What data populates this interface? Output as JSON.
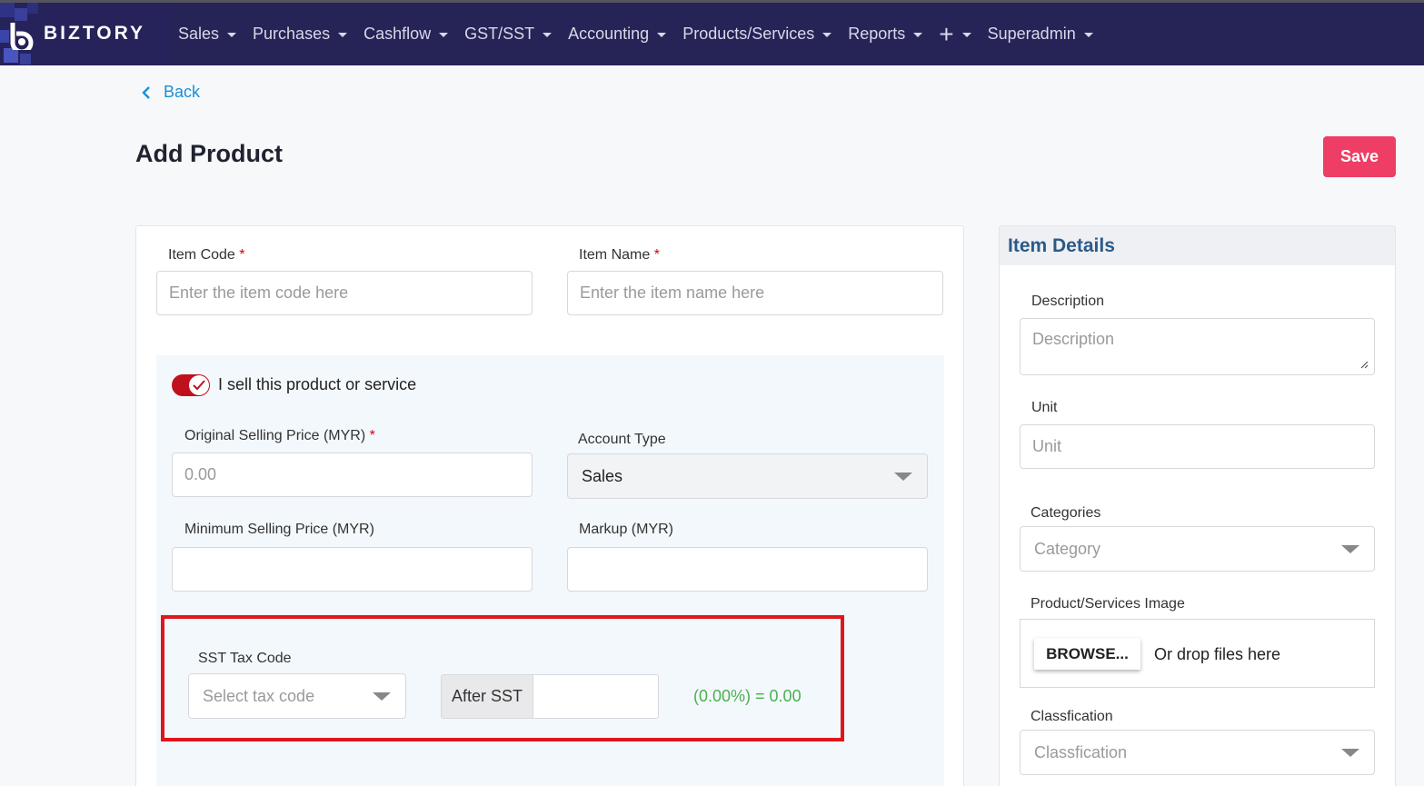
{
  "brand": {
    "name": "BIZTORY"
  },
  "nav": {
    "items": [
      {
        "label": "Sales",
        "icon": "chevron-down-icon"
      },
      {
        "label": "Purchases",
        "icon": "chevron-down-icon"
      },
      {
        "label": "Cashflow",
        "icon": "chevron-down-icon"
      },
      {
        "label": "GST/SST",
        "icon": "chevron-down-icon"
      },
      {
        "label": "Accounting",
        "icon": "chevron-down-icon"
      },
      {
        "label": "Products/Services",
        "icon": "chevron-down-icon"
      },
      {
        "label": "Reports",
        "icon": "chevron-down-icon"
      },
      {
        "label": "+",
        "icon": "plus-icon"
      },
      {
        "label": "Superadmin",
        "icon": "chevron-down-icon"
      }
    ]
  },
  "back_label": "Back",
  "page_title": "Add Product",
  "save_label": "Save",
  "form": {
    "item_code": {
      "label": "Item Code",
      "required": "*",
      "placeholder": "Enter the item code here"
    },
    "item_name": {
      "label": "Item Name",
      "required": "*",
      "placeholder": "Enter the item name here"
    },
    "sell_toggle": {
      "label": "I sell this product or service",
      "checked": true
    },
    "original_price": {
      "label": "Original Selling Price (MYR)",
      "required": "*",
      "placeholder": "0.00"
    },
    "account_type": {
      "label": "Account Type",
      "value": "Sales"
    },
    "min_price": {
      "label": "Minimum Selling Price (MYR)",
      "value": ""
    },
    "markup": {
      "label": "Markup (MYR)",
      "value": ""
    },
    "sst": {
      "label": "SST Tax Code",
      "placeholder": "Select tax code",
      "after_label": "After SST",
      "after_value": "",
      "result": "(0.00%) = 0.00"
    }
  },
  "side": {
    "title": "Item Details",
    "description": {
      "label": "Description",
      "placeholder": "Description"
    },
    "unit": {
      "label": "Unit",
      "placeholder": "Unit"
    },
    "categories": {
      "label": "Categories",
      "placeholder": "Category"
    },
    "image": {
      "label": "Product/Services Image",
      "browse_label": "BROWSE...",
      "drop_text": "Or drop files here"
    },
    "classification": {
      "label": "Classfication",
      "placeholder": "Classfication"
    }
  },
  "colors": {
    "topbar": "#262357",
    "accent_link": "#1a8fd6",
    "save": "#ee3e66",
    "toggle_on": "#c0101e",
    "highlight_box": "#e0161d",
    "result_text": "#4caf50"
  }
}
